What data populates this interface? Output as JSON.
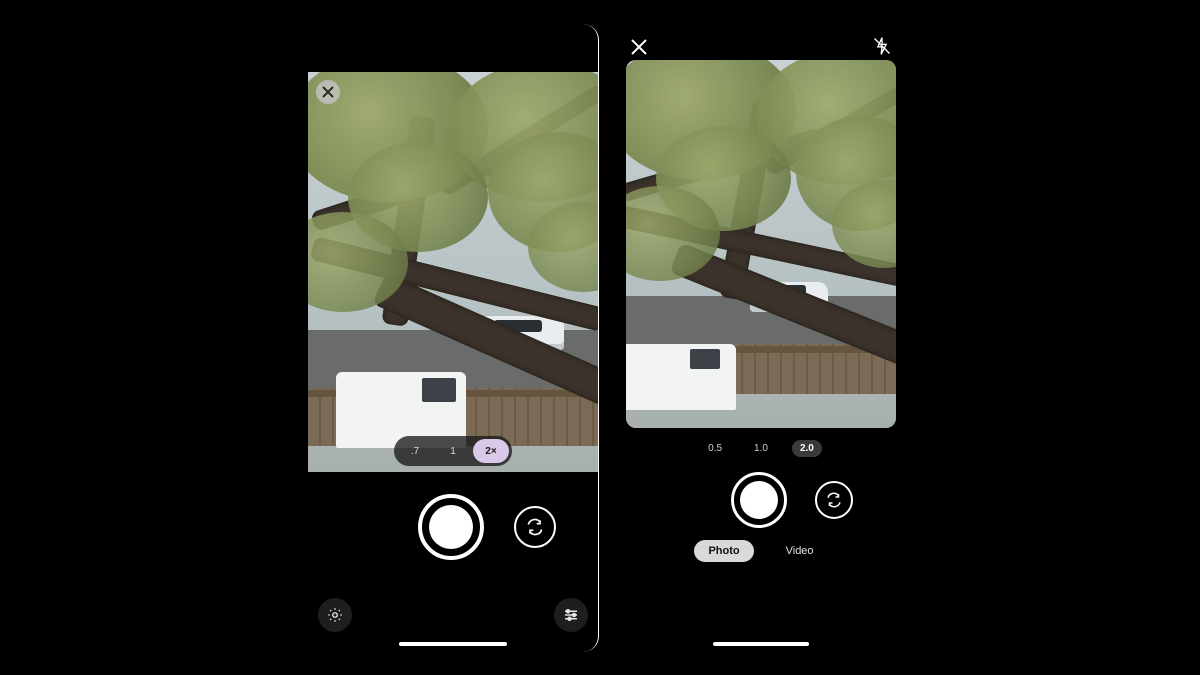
{
  "left_camera": {
    "zoom_options": [
      ".7",
      "1",
      "2×"
    ],
    "zoom_selected_index": 2
  },
  "right_camera": {
    "zoom_options": [
      "0.5",
      "1.0",
      "2.0"
    ],
    "zoom_selected_index": 2,
    "modes": [
      "Photo",
      "Video"
    ],
    "mode_selected_index": 0
  }
}
